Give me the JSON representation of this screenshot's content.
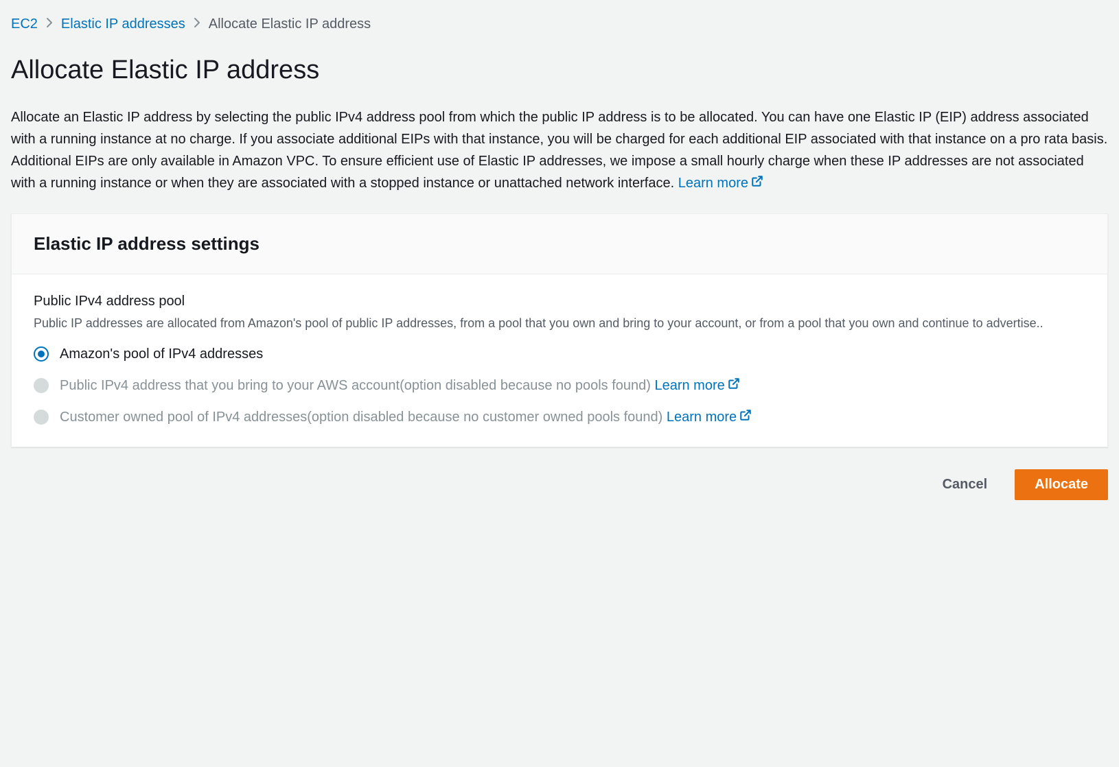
{
  "breadcrumb": {
    "items": [
      {
        "label": "EC2"
      },
      {
        "label": "Elastic IP addresses"
      }
    ],
    "current": "Allocate Elastic IP address"
  },
  "page": {
    "title": "Allocate Elastic IP address",
    "description": "Allocate an Elastic IP address by selecting the public IPv4 address pool from which the public IP address is to be allocated. You can have one Elastic IP (EIP) address associated with a running instance at no charge. If you associate additional EIPs with that instance, you will be charged for each additional EIP associated with that instance on a pro rata basis. Additional EIPs are only available in Amazon VPC. To ensure efficient use of Elastic IP addresses, we impose a small hourly charge when these IP addresses are not associated with a running instance or when they are associated with a stopped instance or unattached network interface. ",
    "learn_more": "Learn more"
  },
  "settings": {
    "panel_title": "Elastic IP address settings",
    "pool": {
      "label": "Public IPv4 address pool",
      "description": "Public IP addresses are allocated from Amazon's pool of public IP addresses, from a pool that you own and bring to your account, or from a pool that you own and continue to advertise..",
      "options": [
        {
          "label": "Amazon's pool of IPv4 addresses",
          "selected": true,
          "disabled": false
        },
        {
          "label": "Public IPv4 address that you bring to your AWS account(option disabled because no pools found) ",
          "selected": false,
          "disabled": true,
          "learn_more": "Learn more"
        },
        {
          "label": "Customer owned pool of IPv4 addresses(option disabled because no customer owned pools found) ",
          "selected": false,
          "disabled": true,
          "learn_more": "Learn more"
        }
      ]
    }
  },
  "actions": {
    "cancel": "Cancel",
    "allocate": "Allocate"
  }
}
